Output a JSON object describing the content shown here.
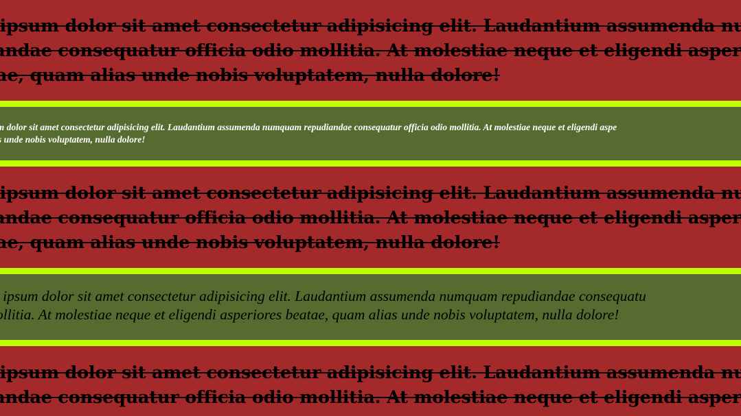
{
  "colors": {
    "red_band": "#a4292b",
    "green_band": "#556b2f",
    "lime_border": "#bfff00"
  },
  "section1": {
    "line1": "m ipsum dolor sit amet consectetur adipisicing elit. Laudantium assumenda nu",
    "line2": "diandae consequatur officia odio mollitia. At molestiae neque et eligendi asper",
    "line3": "ae, quam alias unde nobis voluptatem, nulla dolore!"
  },
  "section2": {
    "line1": "sum dolor sit amet consectetur adipisicing elit. Laudantium assumenda numquam repudiandae consequatur officia odio mollitia. At molestiae neque et eligendi aspe",
    "line2": "s unde nobis voluptatem, nulla dolore!"
  },
  "section3": {
    "line1": "m ipsum dolor sit amet consectetur adipisicing elit. Laudantium assumenda nu",
    "line2": "diandae consequatur officia odio mollitia. At molestiae neque et eligendi asper",
    "line3": "ae, quam alias unde nobis voluptatem, nulla dolore!"
  },
  "section4": {
    "line1": "n ipsum dolor sit amet consectetur adipisicing elit. Laudantium assumenda numquam repudiandae consequatu",
    "line2": "ollitia. At molestiae neque et eligendi asperiores beatae, quam alias unde nobis voluptatem, nulla dolore!"
  },
  "section5": {
    "line1": "m ipsum dolor sit amet consectetur adipisicing elit. Laudantium assumenda nu",
    "line2": "diandae consequatur officia odio mollitia. At molestiae neque et eligendi asper"
  }
}
